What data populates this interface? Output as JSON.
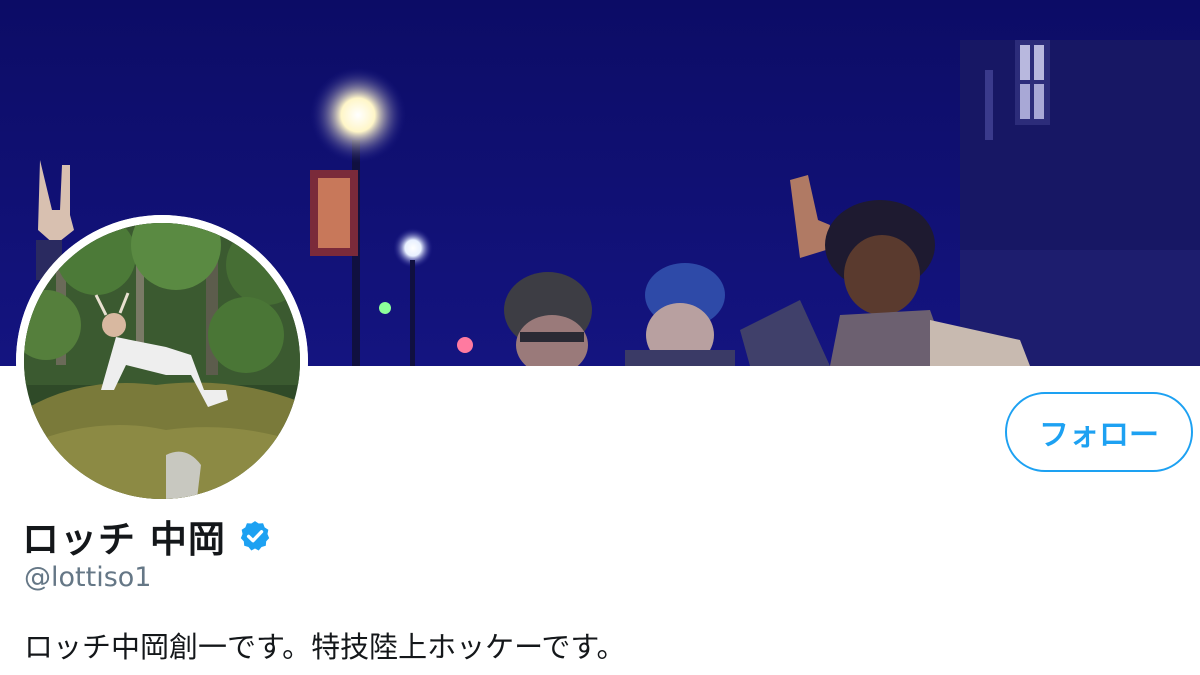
{
  "profile": {
    "display_name": "ロッチ 中岡",
    "handle": "@lottiso1",
    "bio": "ロッチ中岡創一です。特技陸上ホッケーです。",
    "verified": true
  },
  "actions": {
    "follow_label": "フォロー"
  },
  "icons": {
    "verified": "verified-badge-icon"
  },
  "colors": {
    "accent": "#1da1f2",
    "name_text": "#14171a",
    "handle_text": "#657786",
    "banner_bg": "#0f0f6e"
  }
}
